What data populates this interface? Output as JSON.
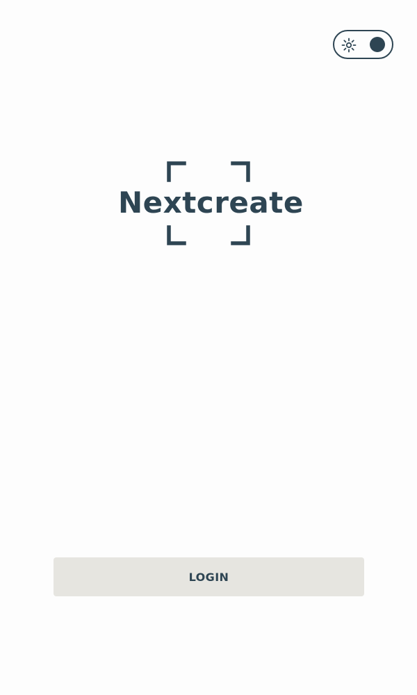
{
  "app": {
    "brand_name": "Nextcreate",
    "brand_color": "#2e4553",
    "background_color": "#fdfdfd"
  },
  "theme_toggle": {
    "icon": "sun-icon",
    "state": "off"
  },
  "actions": {
    "login_label": "LOGIN",
    "login_button_color": "#e6e5e0"
  }
}
